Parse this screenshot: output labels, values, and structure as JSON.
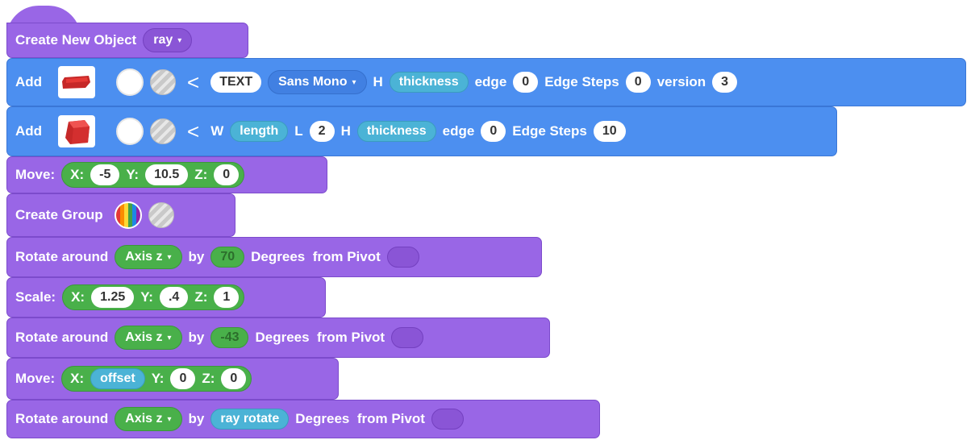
{
  "blocks": {
    "create_object": {
      "label": "Create New Object",
      "name_value": "ray"
    },
    "add_text": {
      "label": "Add",
      "type_value": "TEXT",
      "font_value": "Sans Mono",
      "h_label": "H",
      "h_value": "thickness",
      "edge_label": "edge",
      "edge_value": "0",
      "edge_steps_label": "Edge Steps",
      "edge_steps_value": "0",
      "version_label": "version",
      "version_value": "3"
    },
    "add_cube": {
      "label": "Add",
      "w_label": "W",
      "w_value": "length",
      "l_label": "L",
      "l_value": "2",
      "h_label": "H",
      "h_value": "thickness",
      "edge_label": "edge",
      "edge_value": "0",
      "edge_steps_label": "Edge Steps",
      "edge_steps_value": "10"
    },
    "move_1": {
      "label": "Move:",
      "x_label": "X:",
      "x": "-5",
      "y_label": "Y:",
      "y": "10.5",
      "z_label": "Z:",
      "z": "0"
    },
    "create_group": {
      "label": "Create Group"
    },
    "rotate_1": {
      "label": "Rotate around",
      "axis": "Axis z",
      "by": "by",
      "value": "70",
      "suffix": "Degrees  from Pivot"
    },
    "scale": {
      "label": "Scale:",
      "x_label": "X:",
      "x": "1.25",
      "y_label": "Y:",
      "y": ".4",
      "z_label": "Z:",
      "z": "1"
    },
    "rotate_2": {
      "label": "Rotate around",
      "axis": "Axis z",
      "by": "by",
      "value": "-43",
      "suffix": "Degrees  from Pivot"
    },
    "move_2": {
      "label": "Move:",
      "x_label": "X:",
      "x": "offset",
      "y_label": "Y:",
      "y": "0",
      "z_label": "Z:",
      "z": "0"
    },
    "rotate_3": {
      "label": "Rotate around",
      "axis": "Axis z",
      "by": "by",
      "value": "ray rotate",
      "suffix": "Degrees  from Pivot"
    }
  },
  "icons": {
    "back": "<",
    "caret": "▾"
  },
  "colors": {
    "motion_purple": "#9966e6",
    "shape_blue": "#4c8ff0",
    "operator_green": "#49b04a",
    "variable_cyan": "#4bb3d6"
  }
}
